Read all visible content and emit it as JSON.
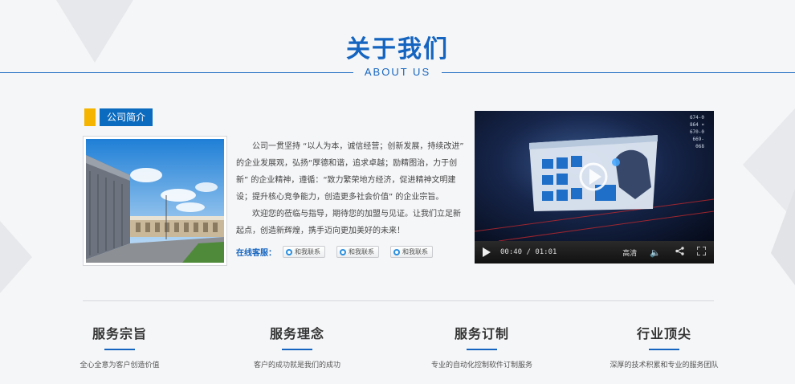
{
  "section": {
    "title": "关于我们",
    "subtitle": "ABOUT US"
  },
  "intro": {
    "tag": "公司简介",
    "paragraphs": [
      "公司一贯坚持 “以人为本，诚信经营；创新发展，持续改进” 的企业发展观，弘扬“厚德和谐，追求卓越；励精图治，力于创新” 的企业精神，遵循：“致力繁荣地方经济，促进精神文明建设；提升核心竞争能力，创造更多社会价值” 的企业宗旨。",
      "欢迎您的莅临与指导，期待您的加盟与见证。让我们立足新起点，创造新辉煌，携手迈向更加美好的未来！"
    ],
    "online_label": "在线客服：",
    "qq_buttons": [
      "和我联系",
      "和我联系",
      "和我联系"
    ]
  },
  "video": {
    "time": "00:40 / 01:01",
    "quality": "高清",
    "progress": 0.66,
    "screen_codes": [
      "674-0",
      "864 ¤",
      "670-0",
      "669-",
      "068"
    ]
  },
  "features": [
    {
      "title": "服务宗旨",
      "desc": "全心全意为客户创造价值"
    },
    {
      "title": "服务理念",
      "desc": "客户的成功就是我们的成功"
    },
    {
      "title": "服务订制",
      "desc": "专业的自动化控制软件订制服务"
    },
    {
      "title": "行业顶尖",
      "desc": "深厚的技术积累和专业的服务团队"
    }
  ],
  "colors": {
    "brand": "#1565c0",
    "tag_accent": "#f5b400"
  }
}
